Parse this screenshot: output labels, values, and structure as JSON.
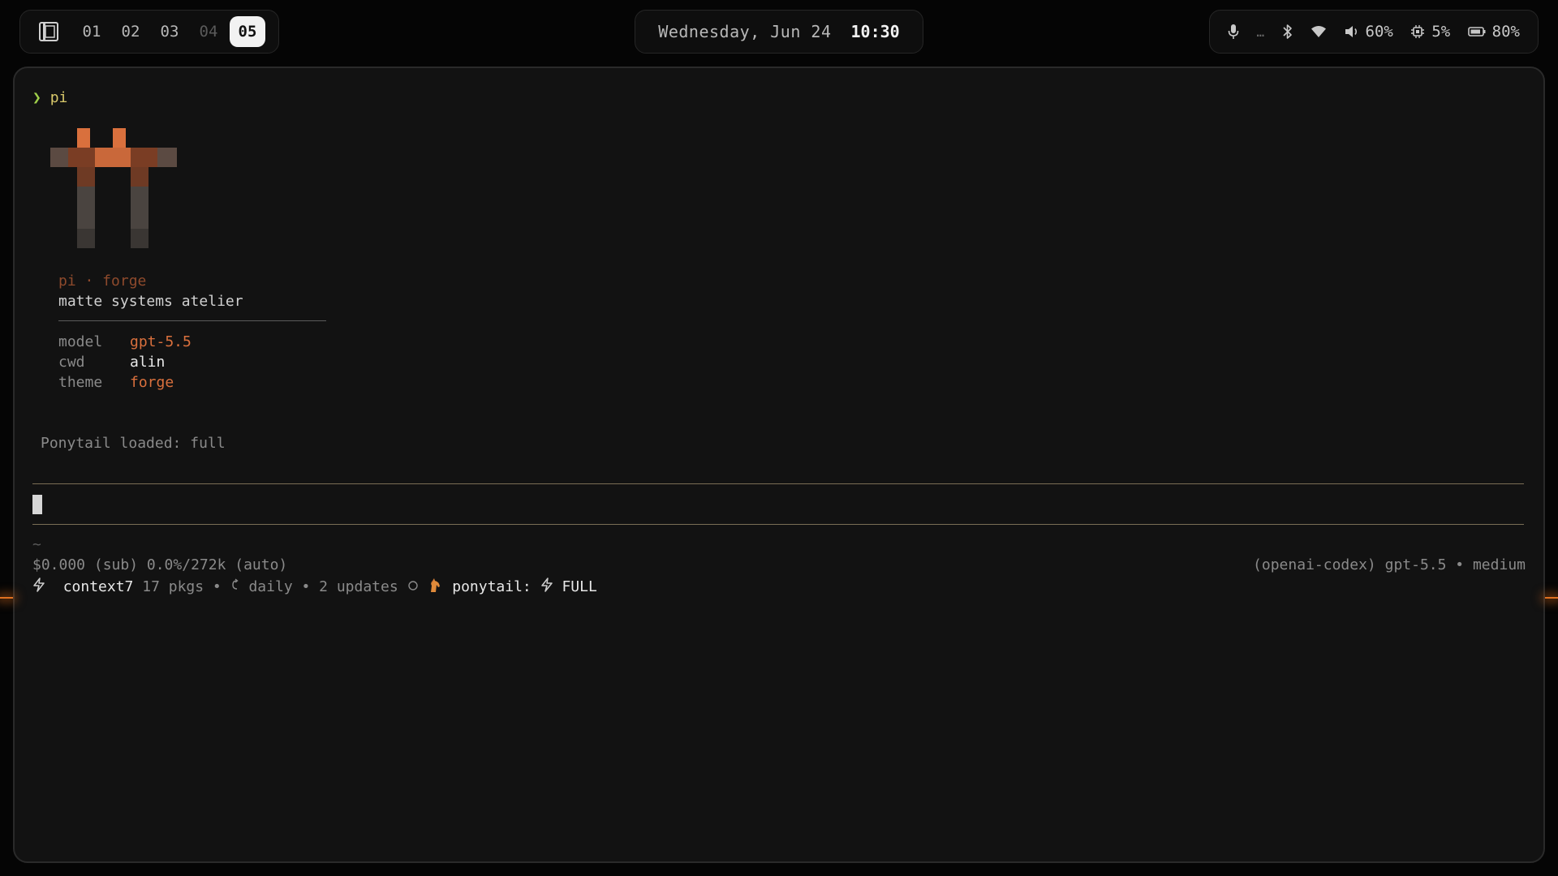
{
  "topbar": {
    "workspaces": [
      {
        "label": "01",
        "state": "normal"
      },
      {
        "label": "02",
        "state": "normal"
      },
      {
        "label": "03",
        "state": "normal"
      },
      {
        "label": "04",
        "state": "dim"
      },
      {
        "label": "05",
        "state": "active"
      }
    ],
    "clock": {
      "date": "Wednesday, Jun 24",
      "time": "10:30"
    },
    "status": {
      "overflow": "…",
      "volume": "60%",
      "cpu": "5%",
      "battery": "80%"
    }
  },
  "terminal": {
    "prompt_symbol": "❯",
    "command": "pi",
    "brand_line": "pi · forge",
    "tagline": "matte systems atelier",
    "info": [
      {
        "key": "model",
        "value": "gpt-5.5",
        "accent": true
      },
      {
        "key": "cwd",
        "value": "alin",
        "accent": false
      },
      {
        "key": "theme",
        "value": "forge",
        "accent": true
      }
    ],
    "loaded_message": "Ponytail loaded: full",
    "footer": {
      "dir": "~",
      "cost_line": "$0.000 (sub) 0.0%/272k (auto)",
      "provider_line": "(openai-codex) gpt-5.5 • medium",
      "ext_name": "context7",
      "pkgs": "17 pkgs •",
      "schedule": "daily • 2 updates",
      "ponytail_label": "ponytail:",
      "ponytail_mode": "FULL"
    }
  },
  "colors": {
    "accent": "#d9703d",
    "prompt_green": "#9fcf4a",
    "prompt_yellow": "#d8c86a",
    "background": "#121212"
  }
}
